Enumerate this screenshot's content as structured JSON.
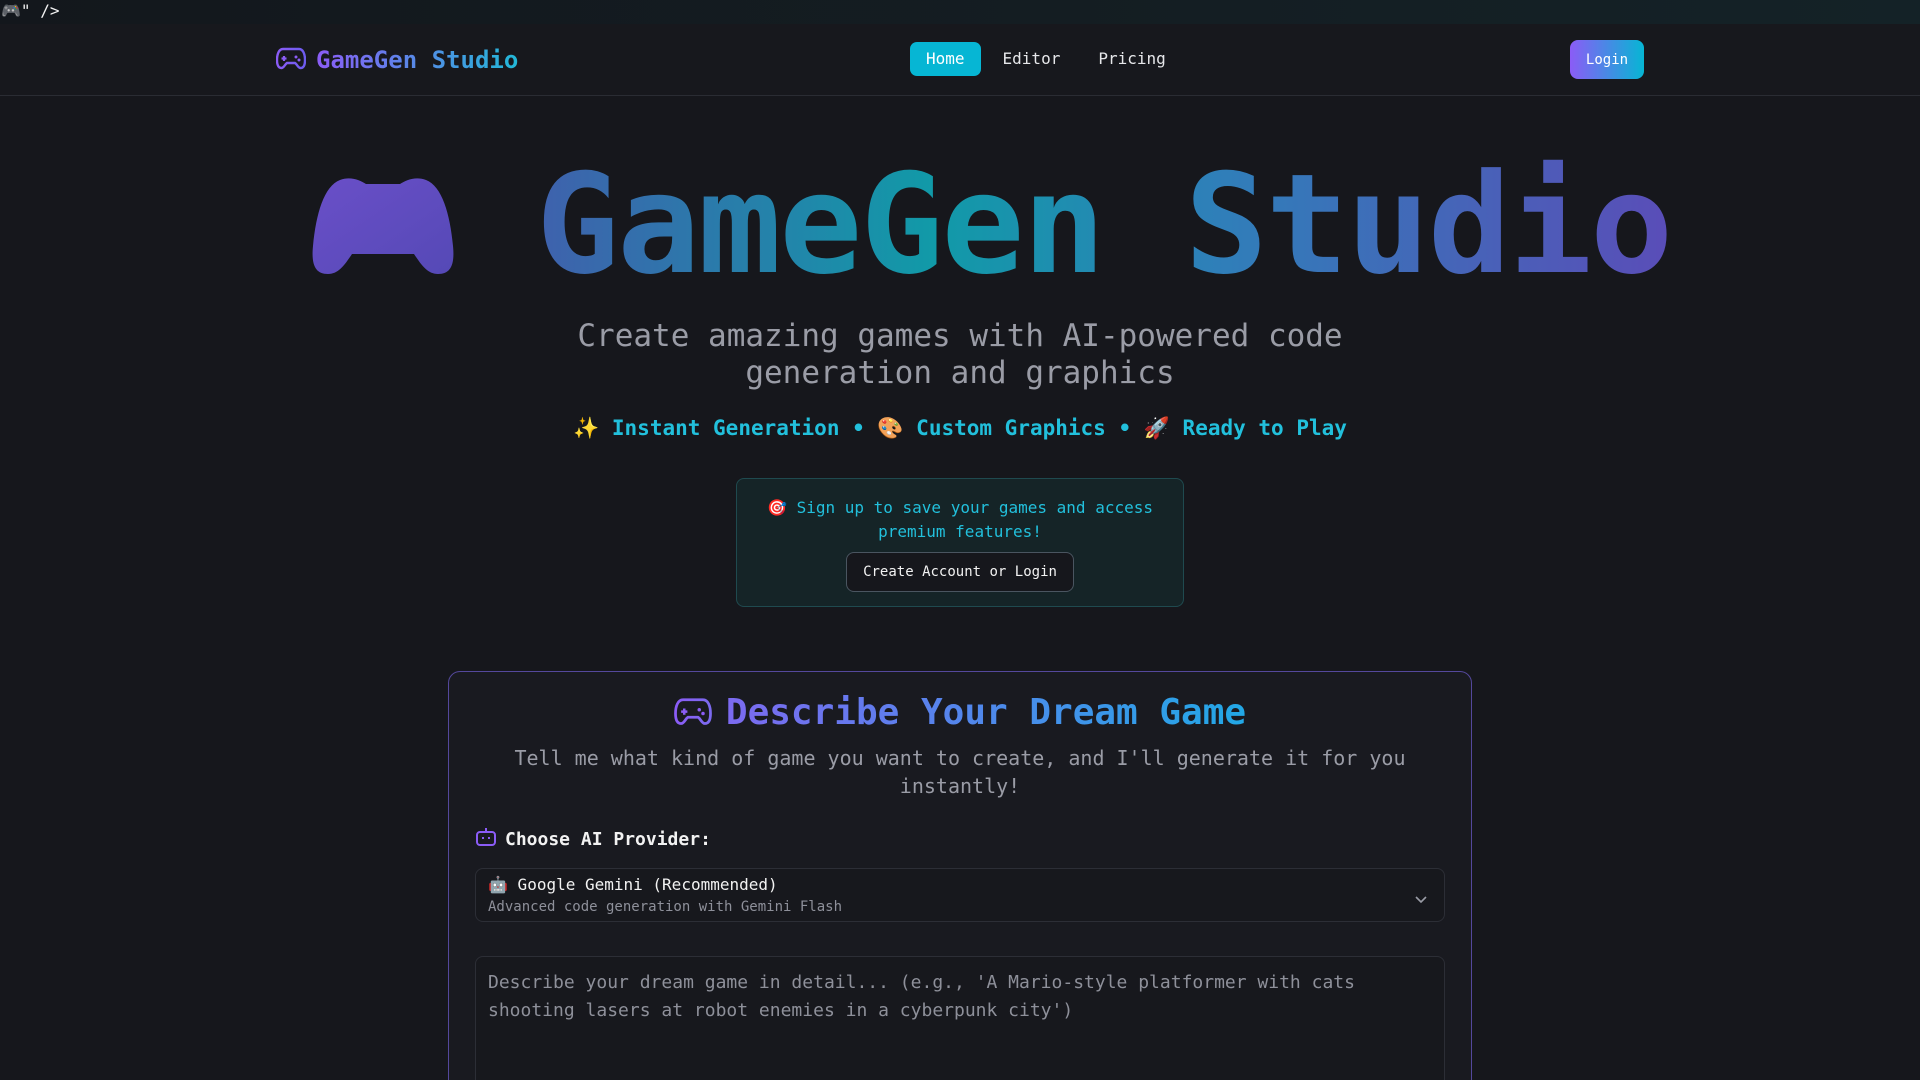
{
  "stray_text": "🎮\" />",
  "nav": {
    "brand": "GameGen Studio",
    "links": [
      {
        "label": "Home",
        "active": true
      },
      {
        "label": "Editor",
        "active": false
      },
      {
        "label": "Pricing",
        "active": false
      }
    ],
    "login_label": "Login"
  },
  "hero": {
    "title": "GameGen Studio",
    "subtitle": "Create amazing games with AI-powered code generation and graphics",
    "features": "✨ Instant Generation • 🎨 Custom Graphics • 🚀 Ready to Play"
  },
  "signup": {
    "message": "🎯 Sign up to save your games and access premium features!",
    "button_label": "Create Account or Login"
  },
  "card": {
    "title": "Describe Your Dream Game",
    "description": "Tell me what kind of game you want to create, and I'll generate it for you instantly!",
    "provider_label": "Choose AI Provider:",
    "provider_selected": "🤖 Google Gemini (Recommended)",
    "provider_hint": "Advanced code generation with Gemini Flash",
    "prompt_placeholder": "Describe your dream game in detail... (e.g., 'A Mario-style platformer with cats shooting lasers at robot enemies in a cyberpunk city')"
  },
  "colors": {
    "accent_cyan": "#06b6d4",
    "accent_purple": "#8b5cf6",
    "background": "#16171c"
  }
}
